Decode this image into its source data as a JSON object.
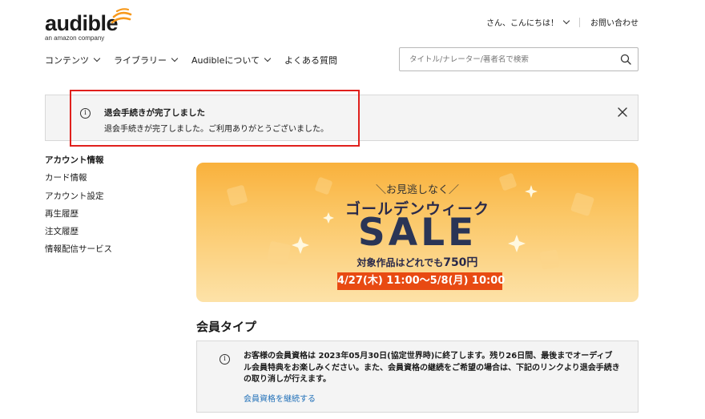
{
  "brand": {
    "logo_text": "audible",
    "logo_sub": "an amazon company",
    "accent_color": "#f7991c"
  },
  "header": {
    "greeting": "さん、こんにちは！",
    "contact": "お問い合わせ"
  },
  "nav": {
    "items": [
      {
        "label": "コンテンツ",
        "dropdown": true
      },
      {
        "label": "ライブラリー",
        "dropdown": true
      },
      {
        "label": "Audibleについて",
        "dropdown": true
      },
      {
        "label": "よくある質問",
        "dropdown": false
      }
    ]
  },
  "search": {
    "placeholder": "タイトル/ナレーター/著者名で検索",
    "value": ""
  },
  "notice": {
    "title": "退会手続きが完了しました",
    "body": "退会手続きが完了しました。ご利用ありがとうございました。",
    "highlight_color": "#e0201c"
  },
  "sidebar": {
    "items": [
      {
        "label": "アカウント情報",
        "active": true
      },
      {
        "label": "カード情報",
        "active": false
      },
      {
        "label": "アカウント設定",
        "active": false
      },
      {
        "label": "再生履歴",
        "active": false
      },
      {
        "label": "注文履歴",
        "active": false
      },
      {
        "label": "情報配信サービス",
        "active": false
      }
    ]
  },
  "banner": {
    "subtitle": "お見逃しなく",
    "title": "ゴールデンウィーク",
    "sale": "SALE",
    "price_prefix": "対象作品はどれでも",
    "price": "750円",
    "dates": "4/27(木) 11:00～5/8(月) 10:00"
  },
  "membership": {
    "section_title": "会員タイプ",
    "message": "お客様の会員資格は 2023年05月30日(協定世界時)に終了します。残り26日間、最後までオーディブル会員特典をお楽しみください。また、会員資格の継続をご希望の場合は、下記のリンクより退会手続きの取り消しが行えます。",
    "link": "会員資格を継続する"
  }
}
